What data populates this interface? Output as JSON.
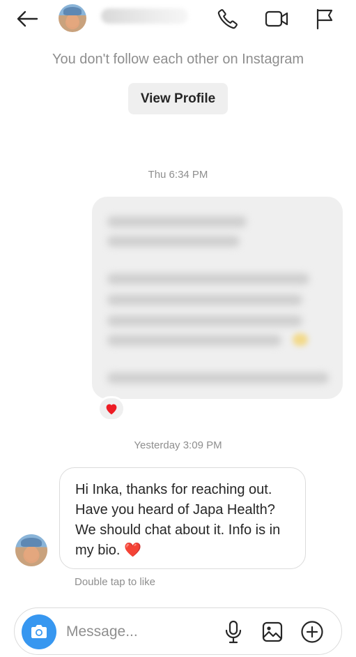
{
  "header": {
    "back_icon": "arrow-left-icon",
    "call_icon": "phone-icon",
    "video_icon": "video-camera-icon",
    "report_icon": "flag-icon"
  },
  "thread": {
    "notice": "You don't follow each other on Instagram",
    "view_profile_label": "View Profile",
    "timestamp_1": "Thu 6:34 PM",
    "reaction": "❤️",
    "timestamp_2": "Yesterday 3:09 PM",
    "incoming_message": "Hi Inka, thanks for reaching out. Have you heard of Japa Health? We should chat about it. Info is in my bio. ❤️",
    "hint": "Double tap to like"
  },
  "composer": {
    "placeholder": "Message...",
    "camera_icon": "camera-icon",
    "mic_icon": "microphone-icon",
    "gallery_icon": "image-icon",
    "plus_icon": "plus-circle-icon"
  },
  "colors": {
    "accent": "#3797f0",
    "heart": "#ed1c24",
    "muted_text": "#8e8e8e",
    "bubble_gray": "#efefef"
  }
}
